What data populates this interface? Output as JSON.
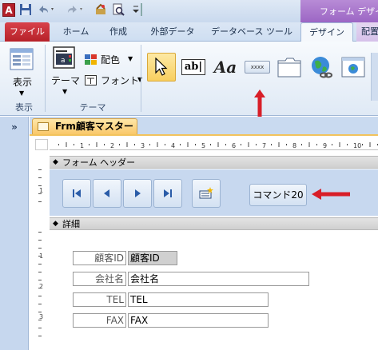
{
  "window": {
    "context_title": "フォーム デザイ"
  },
  "quick_access": {
    "app_icon_letter": "A"
  },
  "tabs": [
    {
      "label": "ファイル"
    },
    {
      "label": "ホーム"
    },
    {
      "label": "作成"
    },
    {
      "label": "外部データ"
    },
    {
      "label": "データベース ツール"
    },
    {
      "label": "デザイン"
    },
    {
      "label": "配置"
    }
  ],
  "ribbon": {
    "view_group": {
      "button_label": "表示",
      "group_label": "表示"
    },
    "theme_group": {
      "theme_label": "テーマ",
      "color_label": "配色",
      "font_label": "フォント",
      "group_label": "テーマ"
    },
    "controls": {
      "button_control_text": "xxxx",
      "textbox_text": "ab|",
      "label_text": "Aa"
    }
  },
  "document": {
    "tab_label": "Frm顧客マスター",
    "form_header_label": "フォーム ヘッダー",
    "detail_label": "詳細",
    "command_button_label": "コマンド20",
    "fields": [
      {
        "label": "顧客ID",
        "value": "顧客ID"
      },
      {
        "label": "会社名",
        "value": "会社名"
      },
      {
        "label": "TEL",
        "value": "TEL"
      },
      {
        "label": "FAX",
        "value": "FAX"
      }
    ]
  },
  "ruler": {
    "h_numbers": [
      "1",
      "2",
      "3",
      "4",
      "5",
      "6",
      "7",
      "8",
      "9",
      "10"
    ],
    "v_numbers": [
      "1",
      "1",
      "2",
      "3"
    ]
  },
  "colors": {
    "accent_red": "#d81e28",
    "file_tab": "#b62129",
    "context_purple": "#9c66c4"
  }
}
